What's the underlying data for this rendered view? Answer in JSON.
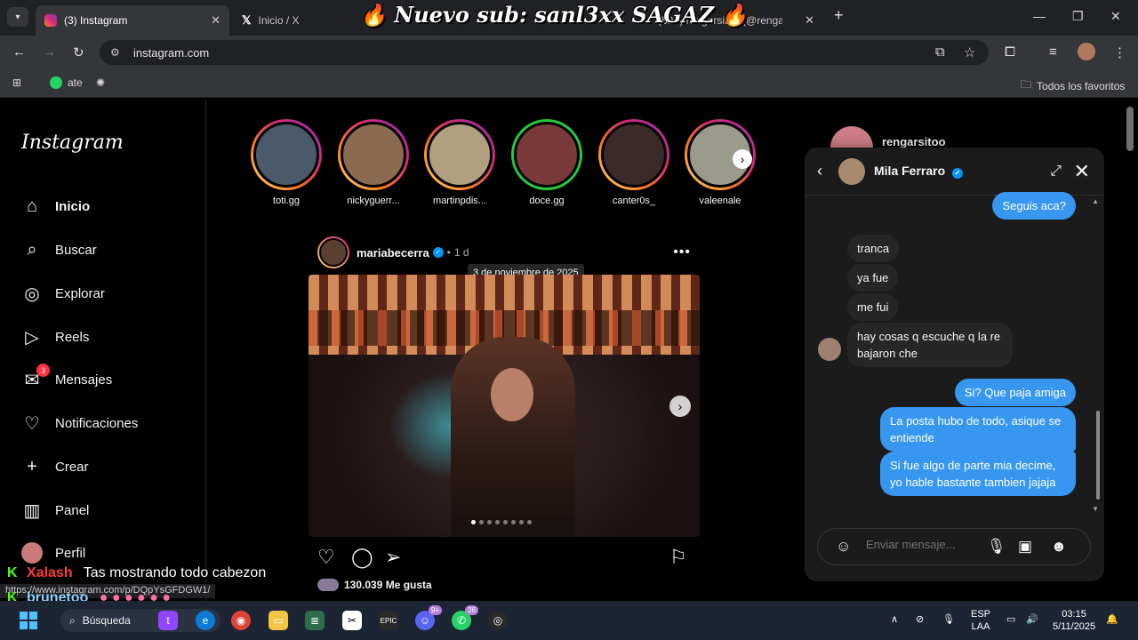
{
  "browser": {
    "tabs": [
      {
        "title": "(3) Instagram",
        "icon": "instagram-icon",
        "active": true
      },
      {
        "title": "Inicio / X",
        "icon": "x-icon",
        "active": false
      },
      {
        "title": "(59+) rengarsitoo (@rengarsito",
        "icon": "flame-icon",
        "active": false
      }
    ],
    "url": "instagram.com",
    "bookmarks": [
      {
        "label": "ate",
        "icon": "whatsapp-icon"
      },
      {
        "label": "",
        "icon": "chatgpt-icon"
      }
    ],
    "all_bookmarks_label": "Todos los favoritos",
    "status_url": "https://www.instagram.com/p/DQpYsGFDGW1/"
  },
  "overlay_title": "Nuevo sub: sanl3xx SAGAZ",
  "sidebar": {
    "logo": "Instagram",
    "items": [
      {
        "label": "Inicio",
        "icon": "home-icon",
        "bold": true
      },
      {
        "label": "Buscar",
        "icon": "search-icon"
      },
      {
        "label": "Explorar",
        "icon": "compass-icon"
      },
      {
        "label": "Reels",
        "icon": "reels-icon"
      },
      {
        "label": "Mensajes",
        "icon": "messenger-icon",
        "badge": "3"
      },
      {
        "label": "Notificaciones",
        "icon": "heart-icon"
      },
      {
        "label": "Crear",
        "icon": "plus-icon"
      },
      {
        "label": "Panel",
        "icon": "chart-icon"
      },
      {
        "label": "Perfil",
        "icon": "avatar-icon"
      }
    ]
  },
  "stories": [
    {
      "name": "toti.gg"
    },
    {
      "name": "nickyguerr..."
    },
    {
      "name": "martinpdis..."
    },
    {
      "name": "doce.gg",
      "close_friend": true
    },
    {
      "name": "canter0s_"
    },
    {
      "name": "valeenale"
    }
  ],
  "post": {
    "username": "mariabecerra",
    "separator": "•",
    "time": "1 d",
    "tooltip": "3 de noviembre de 2025",
    "likes": "130.039 Me gusta",
    "carousel_index": 1,
    "carousel_total": 8
  },
  "right_panel": {
    "username": "rengarsitoo"
  },
  "chat": {
    "contact": "Mila Ferraro",
    "messages": [
      {
        "dir": "out",
        "text": "Seguis aca?"
      },
      {
        "dir": "in",
        "text": "tranca"
      },
      {
        "dir": "in",
        "text": "ya fue"
      },
      {
        "dir": "in",
        "text": "me fui"
      },
      {
        "dir": "in",
        "text": "hay cosas q escuche q la re bajaron che"
      },
      {
        "dir": "out",
        "text": "Si? Que paja amiga"
      },
      {
        "dir": "out",
        "text": "La posta hubo de todo, asique se entiende"
      },
      {
        "dir": "out",
        "text": "Si fue algo de parte mia decime, yo hable bastante tambien jajaja"
      }
    ],
    "input_placeholder": "Enviar mensaje..."
  },
  "stream_chat": [
    {
      "user": "Xalash",
      "text": "Tas mostrando todo cabezon"
    },
    {
      "user": "brunetoo",
      "text": ""
    }
  ],
  "taskbar": {
    "search_label": "Búsqueda",
    "lang1": "ESP",
    "lang2": "LAA",
    "time": "03:15",
    "date": "5/11/2025",
    "badge_discord": "9+",
    "badge_whatsapp": "26"
  },
  "colors": {
    "accent": "#3797f0",
    "link": "#0095f6",
    "notification": "#ff3040",
    "kick": "#53fc18"
  }
}
